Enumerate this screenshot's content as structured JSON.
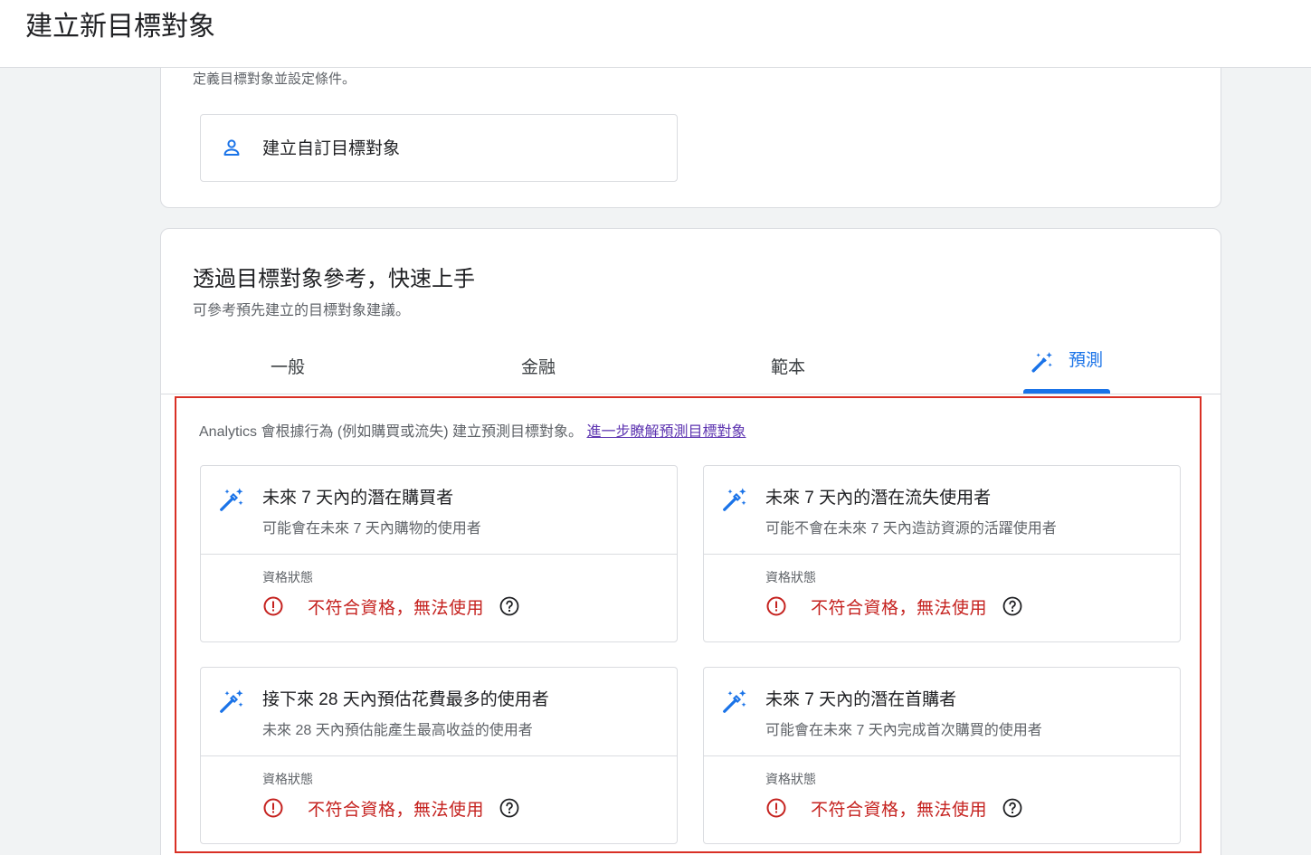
{
  "header": {
    "title": "建立新目標對象"
  },
  "define_section": {
    "description": "定義目標對象並設定條件。",
    "custom_button_label": "建立自訂目標對象"
  },
  "quick_start": {
    "heading": "透過目標對象參考，快速上手",
    "subheading": "可參考預先建立的目標對象建議。",
    "tabs": [
      {
        "label": "一般"
      },
      {
        "label": "金融"
      },
      {
        "label": "範本"
      },
      {
        "label": "預測",
        "selected": true
      }
    ]
  },
  "predictive": {
    "intro": "Analytics 會根據行為 (例如購買或流失) 建立預測目標對象。",
    "learn_more": "進一步瞭解預測目標對象",
    "status_label": "資格狀態",
    "status_text": "不符合資格，無法使用",
    "cards": [
      {
        "title": "未來 7 天內的潛在購買者",
        "subtitle": "可能會在未來 7 天內購物的使用者"
      },
      {
        "title": "未來 7 天內的潛在流失使用者",
        "subtitle": "可能不會在未來 7 天內造訪資源的活躍使用者"
      },
      {
        "title": "接下來 28 天內預估花費最多的使用者",
        "subtitle": "未來 28 天內預估能產生最高收益的使用者"
      },
      {
        "title": "未來 7 天內的潛在首購者",
        "subtitle": "可能會在未來 7 天內完成首次購買的使用者"
      }
    ]
  },
  "colors": {
    "accent": "#1a73e8",
    "error": "#c5221f",
    "highlight_box": "#d93025"
  },
  "icons": {
    "custom_button": "person-icon",
    "predictive_tab": "magic-wand-icon",
    "card": "magic-wand-icon",
    "status": "error-icon",
    "help": "help-icon"
  }
}
